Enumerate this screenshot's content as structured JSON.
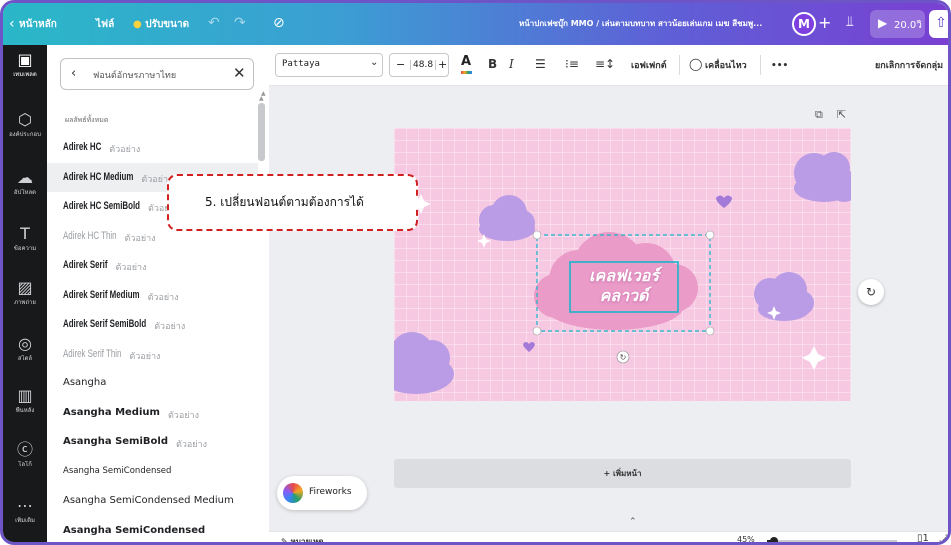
{
  "topbar": {
    "home": "หน้าหลัก",
    "file": "ไฟล์",
    "resize": "ปรับขนาด",
    "doc_title": "หน้าปกเฟซบุ๊ก MMO / เล่นตามบทบาท สาวน้อยเล่นเกม เมฆ สีชมพู...",
    "avatar_letter": "M",
    "play_label": "20.0วิ",
    "brand_gradient": [
      "#2ab7c8",
      "#7a3fd2"
    ]
  },
  "rail": [
    {
      "icon": "layout-icon",
      "glyph": "▣",
      "label": "เทมเพลต"
    },
    {
      "icon": "elements-icon",
      "glyph": "⬡",
      "label": "องค์ประกอบ"
    },
    {
      "icon": "upload-icon",
      "glyph": "☁",
      "label": "อัปโหลด"
    },
    {
      "icon": "text-icon",
      "glyph": "T",
      "label": "ข้อความ"
    },
    {
      "icon": "photos-icon",
      "glyph": "▨",
      "label": "ภาพถ่าย"
    },
    {
      "icon": "styles-icon",
      "glyph": "◎",
      "label": "สไตล์"
    },
    {
      "icon": "background-icon",
      "glyph": "▥",
      "label": "พื้นหลัง"
    },
    {
      "icon": "logo-icon",
      "glyph": "ⓒ",
      "label": "โลโก้"
    },
    {
      "icon": "more-icon",
      "glyph": "⋯",
      "label": "เพิ่มเติม"
    }
  ],
  "panel": {
    "search_value": "ฟอนต์อักษรภาษาไทย",
    "results_label": "ผลลัพธ์ทั้งหมด",
    "fonts": [
      {
        "name": "Adirek HC",
        "sample": "ตัวอย่าง",
        "style": "condensed"
      },
      {
        "name": "Adirek HC Medium",
        "sample": "ตัวอย่าง",
        "style": "condensed"
      },
      {
        "name": "Adirek HC SemiBold",
        "sample": "ตัวอย่าง",
        "style": "condensed"
      },
      {
        "name": "Adirek HC Thin",
        "sample": "ตัวอย่าง",
        "style": "condensed thin"
      },
      {
        "name": "Adirek Serif",
        "sample": "ตัวอย่าง",
        "style": "condensed"
      },
      {
        "name": "Adirek Serif Medium",
        "sample": "ตัวอย่าง",
        "style": "condensed"
      },
      {
        "name": "Adirek Serif SemiBold",
        "sample": "ตัวอย่าง",
        "style": "condensed"
      },
      {
        "name": "Adirek Serif Thin",
        "sample": "ตัวอย่าง",
        "style": "condensed thin"
      },
      {
        "name": "Asangha",
        "sample": "",
        "style": ""
      },
      {
        "name": "Asangha Medium",
        "sample": "ตัวอย่าง",
        "style": "med"
      },
      {
        "name": "Asangha SemiBold",
        "sample": "ตัวอย่าง",
        "style": "bold"
      },
      {
        "name": "Asangha SemiCondensed",
        "sample": "",
        "style": "small"
      },
      {
        "name": "Asangha SemiCondensed Medium",
        "sample": "",
        "style": ""
      },
      {
        "name": "Asangha SemiCondensed",
        "sample": "",
        "style": "bold"
      }
    ]
  },
  "callout": {
    "text": "5. เปลี่ยนฟอนต์ตามต้องการได้",
    "border_color": "#d0201f"
  },
  "toolbar": {
    "font_value": "Pattaya",
    "font_size": "48.8",
    "minus": "−",
    "plus": "+",
    "bold": "B",
    "italic": "I",
    "effects": "เอฟเฟกต์",
    "animate": "เคลื่อนไหว",
    "more": "•••",
    "ungroup": "ยกเลิกการจัดกลุ่ม"
  },
  "design": {
    "line1": "เคลฟเวอร์",
    "line2": "คลาวด์",
    "background": "#f7c8e2",
    "cloud_purple": "#b99be6",
    "cloud_pink": "#ea9bc8",
    "title_color": "#ffffff"
  },
  "canvas": {
    "add_page": "+ เพิ่มหน้า",
    "fireworks": "Fireworks",
    "notes": "หมายเหตุ",
    "zoom": "45%",
    "zoom_value": 0.45,
    "page_count": "1"
  }
}
